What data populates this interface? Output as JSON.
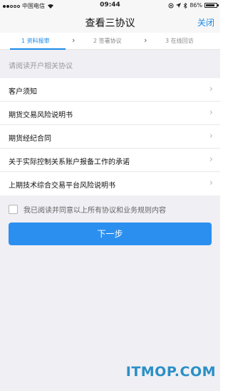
{
  "status_bar": {
    "carrier": "中国电信",
    "time": "09:44",
    "battery": "86%",
    "battery_level": 0.86
  },
  "navbar": {
    "title": "查看三协议",
    "close_label": "关闭"
  },
  "steps": [
    {
      "label": "1 资料报审",
      "active": true
    },
    {
      "label": "2 签署协议",
      "active": false
    },
    {
      "label": "3 在线回访",
      "active": false
    }
  ],
  "section": {
    "header": "请阅读开户相关协议"
  },
  "agreements": [
    {
      "label": "客户须知"
    },
    {
      "label": "期货交易风险说明书"
    },
    {
      "label": "期货经纪合同"
    },
    {
      "label": "关于实际控制关系账户报备工作的承诺"
    },
    {
      "label": "上期技术综合交易平台风险说明书"
    }
  ],
  "agree": {
    "text": "我已阅读并同意以上所有协议和业务规则内容",
    "checked": false
  },
  "next_button": {
    "label": "下一步"
  },
  "watermark": "ITMOP.COM",
  "colors": {
    "accent": "#1a8ae8",
    "button": "#2b8ff0",
    "background": "#efeff4"
  }
}
